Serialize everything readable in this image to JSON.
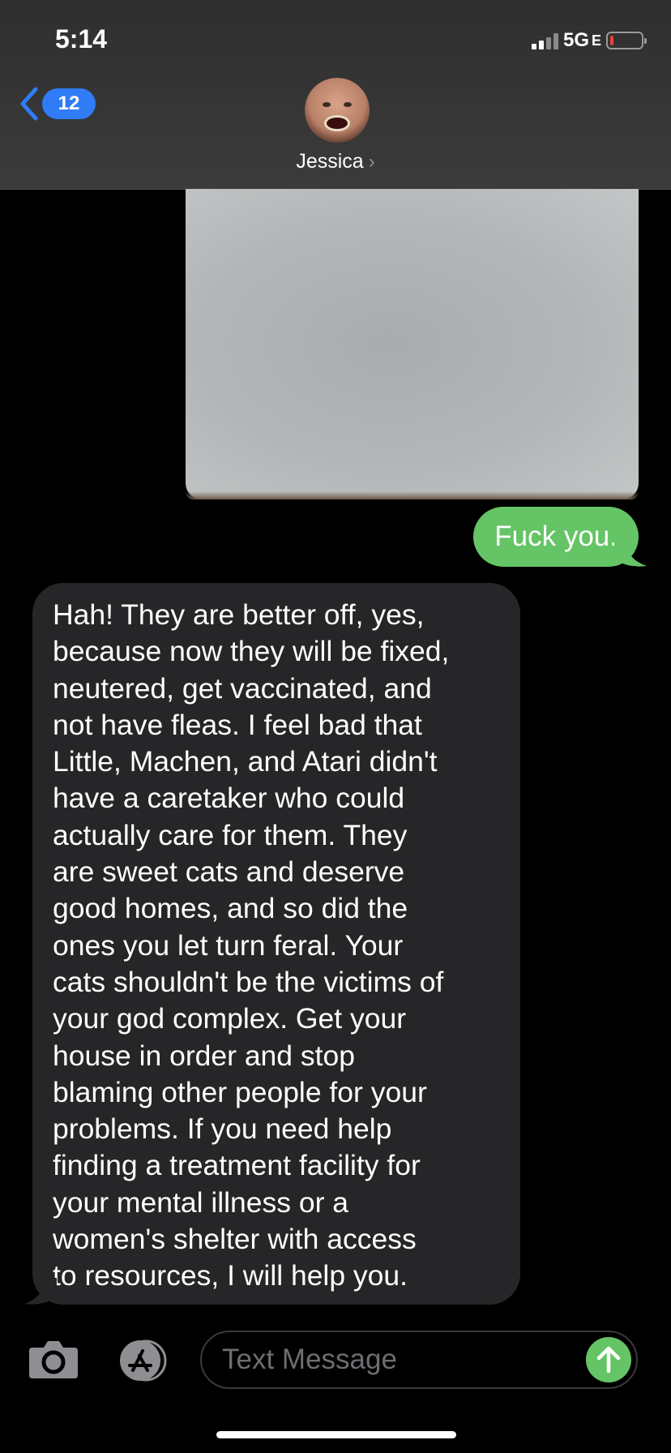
{
  "status_bar": {
    "time": "5:14",
    "network": "5G",
    "network_suffix": "E",
    "battery_level_percent": 10,
    "colors": {
      "battery_low": "#e5443a"
    }
  },
  "header": {
    "back_count": "12",
    "contact_name": "Jessica",
    "contact_chevron": "›",
    "colors": {
      "back_badge": "#2f7cf6"
    }
  },
  "messages": [
    {
      "type": "image",
      "direction": "sent"
    },
    {
      "type": "text",
      "direction": "sent",
      "text": "Fuck you."
    },
    {
      "type": "text",
      "direction": "received",
      "lines": [
        "Hah! They are better off, yes,",
        "because now they will be fixed,",
        "neutered, get vaccinated, and",
        "not have fleas. I feel bad that",
        "Little, Machen, and Atari didn't",
        "have a caretaker who could",
        "actually care for them.  They",
        "are sweet cats and deserve",
        "good homes, and so did the",
        "ones you let turn feral.  Your",
        "cats shouldn't be the victims of",
        "your god complex. Get your",
        "house in order and stop",
        "blaming other people for your",
        "problems.  If you need help",
        "finding a treatment facility for",
        "your mental illness or a",
        "women's shelter with access",
        "to resources, I will help you."
      ]
    }
  ],
  "composer": {
    "placeholder": "Text Message",
    "icons": [
      "camera-icon",
      "app-store-icon",
      "send-arrow-icon"
    ],
    "colors": {
      "sent_bubble": "#65c466",
      "received_bubble": "#262628"
    }
  }
}
